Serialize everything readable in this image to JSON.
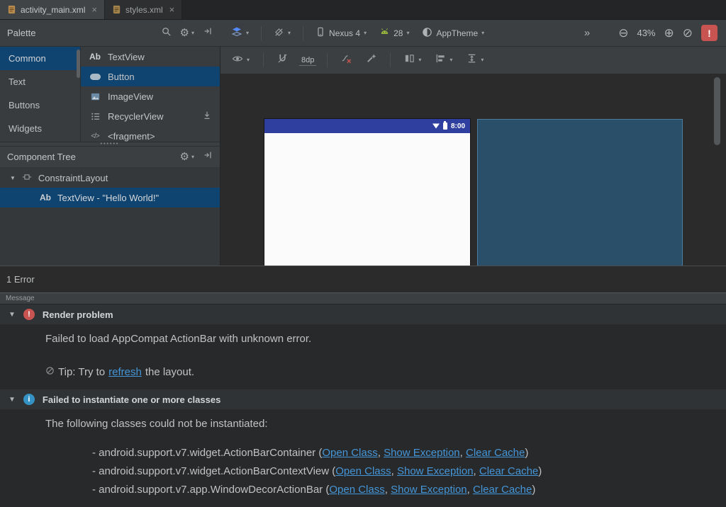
{
  "colors": {
    "selection": "#0f4471",
    "link": "#4596d8",
    "error": "#c75450",
    "info": "#3592c4",
    "statusbar": "#2f3f9f",
    "blueprint": "#2a4f69",
    "android_green": "#9fbf3b"
  },
  "icons": {
    "close": "×",
    "gear": "⚙",
    "chevron": "▾",
    "twisty": "▼",
    "overflow": "»",
    "zoom_out": "⊖",
    "zoom_in": "⊕",
    "zoom_fit": "⊘",
    "dots": "••••••",
    "error_mark": "!",
    "info_mark": "i",
    "textview_glyph": "Ab",
    "fragment_glyph": "</>"
  },
  "tabs": {
    "items": [
      {
        "label": "activity_main.xml"
      },
      {
        "label": "styles.xml"
      }
    ]
  },
  "palette": {
    "title": "Palette",
    "categories": [
      {
        "label": "Common"
      },
      {
        "label": "Text"
      },
      {
        "label": "Buttons"
      },
      {
        "label": "Widgets"
      }
    ],
    "components": [
      {
        "label": "TextView"
      },
      {
        "label": "Button"
      },
      {
        "label": "ImageView"
      },
      {
        "label": "RecyclerView"
      },
      {
        "label": "<fragment>"
      }
    ]
  },
  "design_toolbar": {
    "device": "Nexus 4",
    "api_level": "28",
    "theme": "AppTheme",
    "zoom": "43%"
  },
  "canvas_toolbar": {
    "default_margin": "8dp"
  },
  "component_tree": {
    "title": "Component Tree",
    "root": "ConstraintLayout",
    "child": "TextView - \"Hello World!\""
  },
  "preview": {
    "status_time": "8:00"
  },
  "error_panel": {
    "summary": "1 Error",
    "column_header": "Message",
    "render_problem": {
      "title": "Render problem",
      "message": "Failed to load AppCompat ActionBar with unknown error.",
      "tip_prefix": "Tip: Try to ",
      "tip_link": "refresh",
      "tip_suffix": " the layout."
    },
    "instantiate": {
      "title": "Failed to instantiate one or more classes",
      "intro": "The following classes could not be instantiated:",
      "rows": [
        {
          "text": "- android.support.v7.widget.ActionBarContainer ("
        },
        {
          "text": "- android.support.v7.widget.ActionBarContextView ("
        },
        {
          "text": "- android.support.v7.app.WindowDecorActionBar ("
        }
      ],
      "links": [
        "Open Class",
        "Show Exception",
        "Clear Cache"
      ],
      "separator": ", ",
      "close": ")"
    }
  }
}
